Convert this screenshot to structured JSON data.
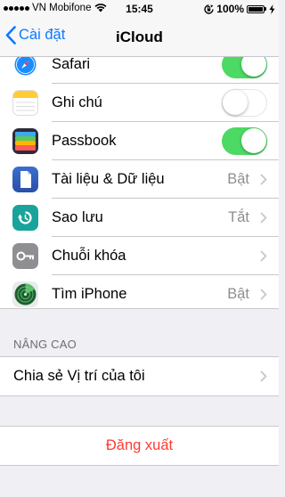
{
  "status_bar": {
    "carrier": "VN Mobifone",
    "time": "15:45",
    "battery": "100%"
  },
  "nav": {
    "back_label": "Cài đặt",
    "title": "iCloud"
  },
  "rows": {
    "safari": {
      "label": "Safari",
      "toggle": "on",
      "icon": "safari-icon"
    },
    "notes": {
      "label": "Ghi chú",
      "toggle": "off",
      "icon": "notes-icon"
    },
    "passbook": {
      "label": "Passbook",
      "toggle": "on",
      "icon": "passbook-icon"
    },
    "documents": {
      "label": "Tài liệu & Dữ liệu",
      "value": "Bật",
      "icon": "document-icon"
    },
    "backup": {
      "label": "Sao lưu",
      "value": "Tắt",
      "icon": "backup-icon"
    },
    "keychain": {
      "label": "Chuỗi khóa",
      "icon": "key-icon"
    },
    "find_iphone": {
      "label": "Tìm iPhone",
      "value": "Bật",
      "icon": "radar-icon"
    }
  },
  "advanced": {
    "header": "NÂNG CAO",
    "share_location": "Chia sẻ Vị trí của tôi"
  },
  "sign_out": "Đăng xuất",
  "colors": {
    "accent": "#0a7aff",
    "toggle_on": "#4cd964",
    "destructive": "#ff3b30",
    "secondary_text": "#8e8e93",
    "background": "#efeff4"
  }
}
